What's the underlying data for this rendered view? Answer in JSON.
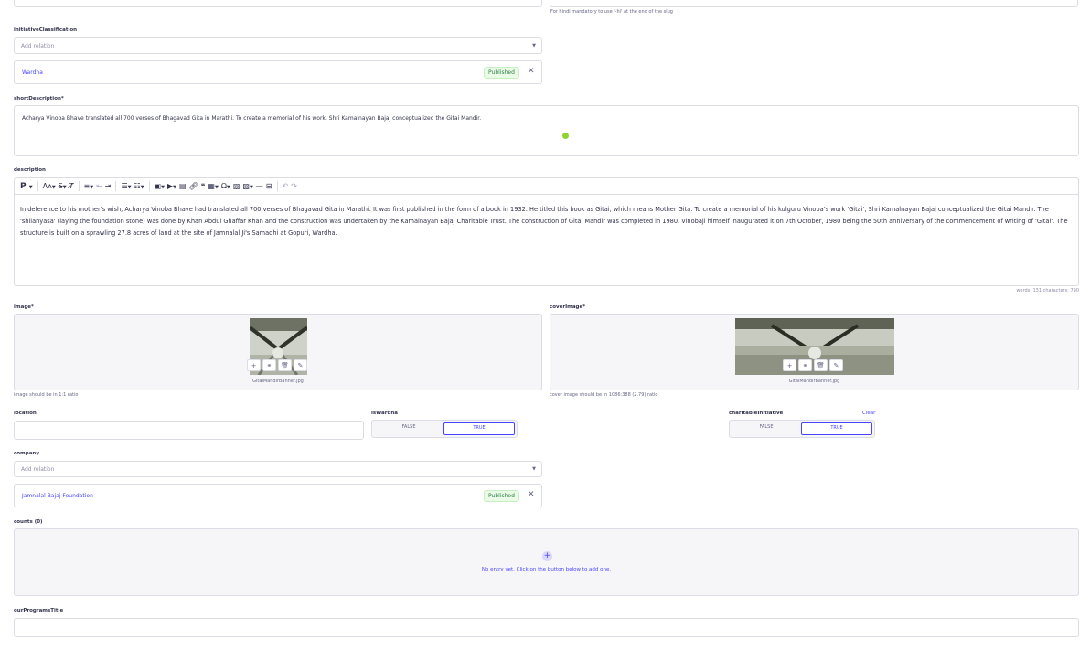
{
  "slug_hint": "For hindi mandatory to use '-hi' at the end of the slug",
  "initiative": {
    "label": "initiativeClassification",
    "placeholder": "Add relation",
    "entry_name": "Wardha",
    "entry_status": "Published"
  },
  "short_description": {
    "label": "shortDescription",
    "required_mark": "*",
    "value": "Acharya Vinoba Bhave translated all 700 verses of Bhagavad Gita in Marathi. To create a memorial of his work, Shri Kamalnayan Bajaj conceptualized the Gitai Mandir."
  },
  "description": {
    "label": "description",
    "toolbar": {
      "paragraph": "P",
      "font_size": "Aᴀ",
      "strike": "S̶",
      "clear_format": "T̸"
    },
    "text": "In deference to his mother’s wish, Acharya Vinoba Bhave had translated all 700 verses of Bhagavad Gita in Marathi. It was first published in the form of a book in 1932. He titled this book as Gitai, which means Mother Gita. To create a memorial of his kulguru Vinoba’s work 'Gitai', Shri Kamalnayan Bajaj conceptualized the Gitai Mandir. The 'shilanyasa' (laying the foundation stone) was done by Khan Abdul Ghaffar Khan and the construction was undertaken by the Kamalnayan Bajaj Charitable Trust. The construction of Gitai Mandir was completed in 1980. Vinobaji himself inaugurated it on 7th October, 1980 being the 50th anniversary of the commencement of writing of 'Gitai'. The structure is built on a sprawling 27.8 acres of land at the site of Jamnalal Ji's Samadhi at Gopuri, Wardha.",
    "counter": "words: 131 characters: 790"
  },
  "image": {
    "label": "image",
    "required_mark": "*",
    "filename": "GitaiMandirBanner.jpg",
    "hint": "image should be in 1:1 ratio"
  },
  "cover_image": {
    "label": "coverImage",
    "required_mark": "*",
    "filename": "GitaiMandirBanner.jpg",
    "hint": "cover image should be in 1086:388 (2.79) ratio"
  },
  "location": {
    "label": "location",
    "value": ""
  },
  "is_wardha": {
    "label": "isWardha",
    "false_label": "FALSE",
    "true_label": "TRUE",
    "value": true
  },
  "charitable": {
    "label": "charitableInitiative",
    "clear_label": "Clear",
    "false_label": "FALSE",
    "true_label": "TRUE",
    "value": true
  },
  "company": {
    "label": "company",
    "placeholder": "Add relation",
    "entry_name": "Jamnalal Bajaj Foundation",
    "entry_status": "Published"
  },
  "counts": {
    "label": "counts (0)",
    "empty_text": "No entry yet. Click on the button below to add one."
  },
  "our_programs_title": {
    "label": "ourProgramsTitle",
    "value": ""
  },
  "colors": {
    "primary": "#4945ff",
    "published_text": "#328048",
    "published_bg": "#eafbe7",
    "border": "#dcdce4",
    "status_dot": "#8fd42a"
  }
}
